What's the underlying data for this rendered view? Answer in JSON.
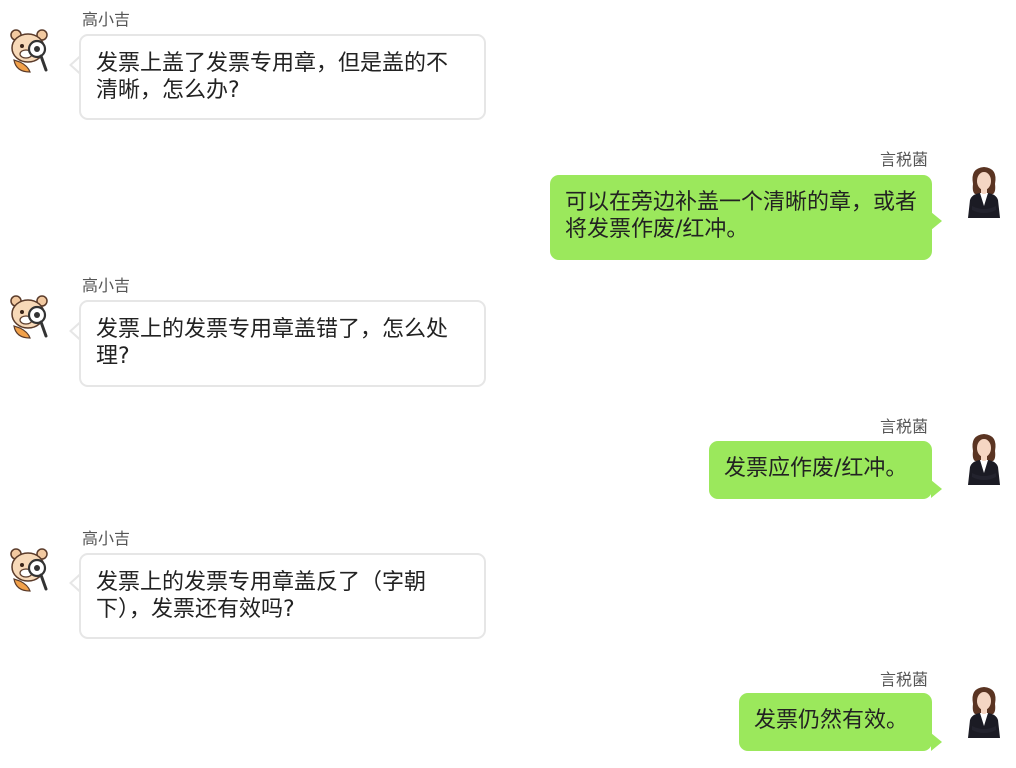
{
  "users": {
    "asker": {
      "name": "高小吉",
      "avatar_icon": "cartoon-bear-magnifier-icon"
    },
    "responder": {
      "name": "言税菌",
      "avatar_icon": "woman-in-suit-icon"
    }
  },
  "colors": {
    "incoming_bubble": "#ffffff",
    "incoming_border": "#e6e6e6",
    "outgoing_bubble": "#9be85c",
    "text": "#222222",
    "name_text": "#555555"
  },
  "messages": [
    {
      "sender": "高小吉",
      "text": "发票上盖了发票专用章，但是盖的不清晰，怎么办?"
    },
    {
      "sender": "言税菌",
      "text": "可以在旁边补盖一个清晰的章，或者将发票作废/红冲。"
    },
    {
      "sender": "高小吉",
      "text": "发票上的发票专用章盖错了，怎么处理?"
    },
    {
      "sender": "言税菌",
      "text": "发票应作废/红冲。"
    },
    {
      "sender": "高小吉",
      "text": "发票上的发票专用章盖反了（字朝下），发票还有效吗?"
    },
    {
      "sender": "言税菌",
      "text": "发票仍然有效。"
    }
  ]
}
